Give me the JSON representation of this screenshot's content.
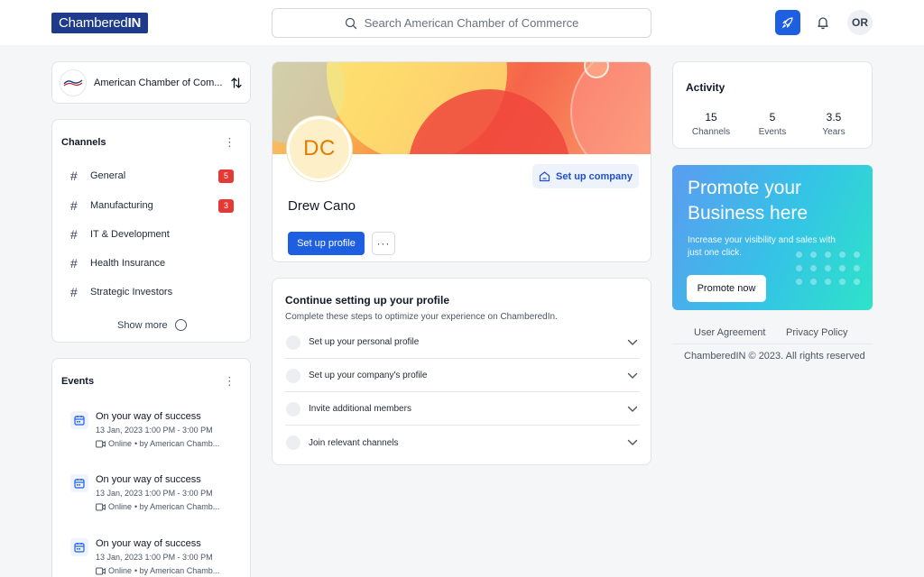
{
  "app": {
    "logo_prefix": "Chambered",
    "logo_suffix": "IN"
  },
  "header": {
    "search_placeholder": "Search American Chamber of Commerce",
    "user_initials": "OR"
  },
  "org_switcher": {
    "name": "American Chamber of Com..."
  },
  "channels": {
    "title": "Channels",
    "items": [
      {
        "label": "General",
        "badge": "5"
      },
      {
        "label": "Manufacturing",
        "badge": "3"
      },
      {
        "label": "IT & Development",
        "badge": null
      },
      {
        "label": "Health Insurance",
        "badge": null
      },
      {
        "label": "Strategic Investors",
        "badge": null
      }
    ],
    "show_more": "Show more"
  },
  "events": {
    "title": "Events",
    "items": [
      {
        "title": "On your way of success",
        "time": "13 Jan, 2023 1:00 PM - 3:00 PM",
        "mode": "Online",
        "host": "• by American Chamb..."
      },
      {
        "title": "On your way of success",
        "time": "13 Jan, 2023 1:00 PM - 3:00 PM",
        "mode": "Online",
        "host": "• by American Chamb..."
      },
      {
        "title": "On your way of success",
        "time": "13 Jan, 2023 1:00 PM - 3:00 PM",
        "mode": "Online",
        "host": "• by American Chamb..."
      }
    ]
  },
  "profile": {
    "initials": "DC",
    "name": "Drew Cano",
    "setup_company": "Set up company",
    "setup_profile": "Set up profile"
  },
  "setup": {
    "title": "Continue setting up your profile",
    "subtitle": "Complete these steps to optimize your experience on ChamberedIn.",
    "steps": [
      "Set up your personal profile",
      "Set up your company's profile",
      "Invite additional members",
      "Join relevant channels"
    ]
  },
  "activity": {
    "title": "Activity",
    "stats": [
      {
        "value": "15",
        "label": "Channels"
      },
      {
        "value": "5",
        "label": "Events"
      },
      {
        "value": "3.5",
        "label": "Years"
      }
    ]
  },
  "promo": {
    "title": "Promote your Business here",
    "text": "Increase your visibility and sales with just one click.",
    "button": "Promote now"
  },
  "footer": {
    "user_agreement": "User Agreement",
    "privacy_policy": "Privacy Policy",
    "copyright": "ChamberedIN © 2023. All rights reserved"
  },
  "colors": {
    "primary": "#1d5fe0",
    "logo_bg": "#1e3a8a",
    "badge": "#e53935"
  }
}
